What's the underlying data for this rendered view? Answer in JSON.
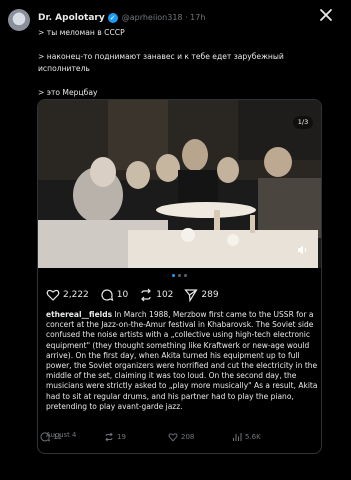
{
  "post": {
    "author_name": "Dr. Apolotary",
    "handle": "@aprheiion318",
    "age": "17h",
    "handle_line": "@aprheiion318 · 17h",
    "lines": [
      "> ты меломан в СССР",
      "> наконец-то поднимают занавес и к тебе едет зарубежный исполнитель",
      "> это Мерцбау"
    ]
  },
  "card": {
    "counter": "1/3",
    "likes": "2,222",
    "replies": "10",
    "reposts": "102",
    "shares": "289",
    "caption_user": "ethereal__fields",
    "caption_text": " In March 1988, Merzbow first came to the USSR for a concert at the Jazz-on-the-Amur festival in Khabarovsk. The Soviet side confused the noise artists with a „collective using high-tech electronic equipment\" (they thought something like Kraftwerk or new-age would arrive). On the first day, when Akita turned his equipment up to full power, the Soviet organizers were horrified and cut the electricity in the middle of the set, claiming it was too loud. On the second day, the musicians were strictly asked to „play more musically\" As a result, Akita had to sit at regular drums, and his partner had to play the piano, pretending to play avant-garde jazz.",
    "date": "August 4"
  },
  "bottom_stats": {
    "replies": "11",
    "reposts": "19",
    "likes": "208",
    "views": "5.6K"
  },
  "colors": {
    "accent": "#1d9bf0",
    "muted": "#71767b",
    "border": "#2f3336"
  }
}
